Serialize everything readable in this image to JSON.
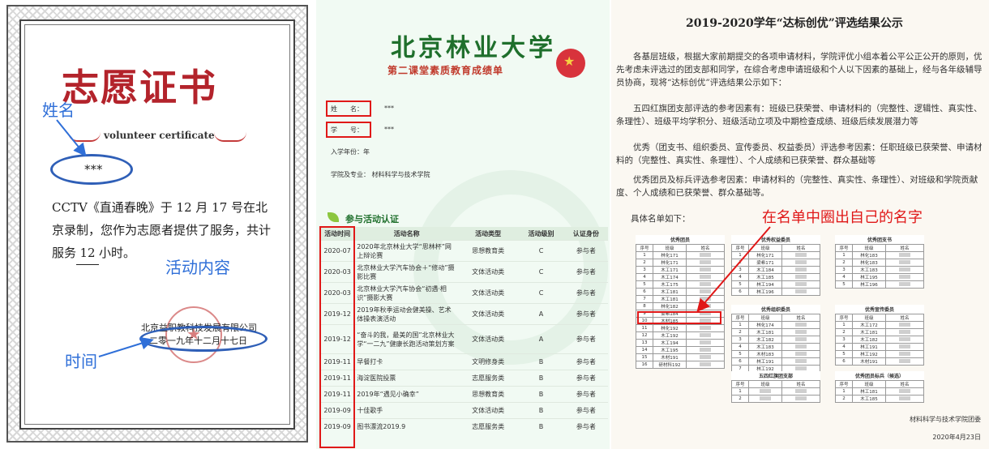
{
  "certificate": {
    "title": "志愿证书",
    "subtitle": "volunteer  certificate",
    "name": "***",
    "body_before_hours": "CCTV《直通春晚》于 12 月 17 号在北京录制，您作为志愿者提供了服务，共计服务",
    "hours": "12",
    "body_after_hours": "小时。",
    "organization": "北京益职教科技发展有限公司",
    "date": "二零一九年十二月十七日",
    "annotations": {
      "name": "姓名",
      "content": "活动内容",
      "time": "时间"
    },
    "colors": {
      "title": "#b3232b",
      "annotation": "#2f6fd8"
    }
  },
  "transcript": {
    "university": "北京林业大学",
    "subtitle": "第二课堂素质教育成绩单",
    "name_label": "姓　　名：",
    "name_value": "***",
    "id_label": "学　　号：",
    "id_value": "***",
    "year_label": "入学年份：年",
    "major_label": "学院及专业：  材料科学与技术学院",
    "section_title": "参与活动认证",
    "columns": [
      "活动时间",
      "活动名称",
      "活动类型",
      "活动级别",
      "认证身份"
    ],
    "rows": [
      [
        "2020-07",
        "2020年北京林业大学“思林杯”网上辩论赛",
        "思想教育类",
        "C",
        "参与者"
      ],
      [
        "2020-03",
        "北京林业大学汽车协会＋“修动”摄影比赛",
        "文体活动类",
        "C",
        "参与者"
      ],
      [
        "2020-03",
        "北京林业大学汽车协会“初遇·相识”摄影大赛",
        "文体活动类",
        "C",
        "参与者"
      ],
      [
        "2019-12",
        "2019年秋季运动会健美操、艺术体操表演活动",
        "文体活动类",
        "A",
        "参与者"
      ],
      [
        "2019-12",
        "“奋斗的我，最美的国”北京林业大学“一二九”健康长跑活动策划方案",
        "文体活动类",
        "A",
        "参与者"
      ],
      [
        "2019-11",
        "早餐打卡",
        "文明修身类",
        "B",
        "参与者"
      ],
      [
        "2019-11",
        "海淀医院投票",
        "志愿服务类",
        "B",
        "参与者"
      ],
      [
        "2019-11",
        "2019年“遇见小确幸”",
        "思想教育类",
        "B",
        "参与者"
      ],
      [
        "2019-09",
        "十佳歌手",
        "文体活动类",
        "B",
        "参与者"
      ],
      [
        "2019-09",
        "图书漂流2019.9",
        "志愿服务类",
        "B",
        "参与者"
      ]
    ]
  },
  "announcement": {
    "title": "2019-2020学年“达标创优”评选结果公示",
    "paragraphs": [
      "各基层班级，根据大家前期提交的各项申请材料，学院评优小组本着公平公正公开的原则，优先考虑未评选过的团支部和同学，在综合考虑申请班级和个人以下因素的基础上，经与各年级辅导员协商，现将“达标创优”评选结果公示如下：",
      "五四红旗团支部评选的参考因素有：班级已获荣誉、申请材料的（完整性、逻辑性、真实性、条理性）、班级平均学积分、班级活动立项及中期检查成绩、班级后续发展潜力等",
      "优秀（团支书、组织委员、宣传委员、权益委员）评选参考因素：任职班级已获荣誉、申请材料的（完整性、真实性、条理性）、个人成绩和已获荣誉、群众基础等",
      "优秀团员及标兵评选参考因素：申请材料的（完整性、真实性、条理性）、对班级和学院贡献度、个人成绩和已获荣誉、群众基础等。"
    ],
    "list_title": "具体名单如下：",
    "note": "在名单中圈出自己的名字",
    "footer": "材料科学与技术学院团委",
    "date": "2020年4月23日",
    "col_labels": {
      "index": "序号",
      "class": "班级",
      "name": "姓名"
    },
    "tables": {
      "excellent_member": {
        "title": "优秀团员",
        "rows": [
          [
            "1",
            "林化171"
          ],
          [
            "2",
            "林化171"
          ],
          [
            "3",
            "木工171"
          ],
          [
            "4",
            "木工174"
          ],
          [
            "5",
            "木工175"
          ],
          [
            "6",
            "木工181"
          ],
          [
            "7",
            "木工181"
          ],
          [
            "8",
            "林化182"
          ],
          [
            "9",
            "梁希184"
          ],
          [
            "10",
            "木材185"
          ],
          [
            "11",
            "林化192"
          ],
          [
            "12",
            "木工192"
          ],
          [
            "13",
            "木工194"
          ],
          [
            "14",
            "木工195"
          ],
          [
            "15",
            "木材191"
          ],
          [
            "16",
            "研材科192"
          ]
        ]
      },
      "rights_member": {
        "title": "优秀权益委员",
        "rows": [
          [
            "1",
            "林化171"
          ],
          [
            "2",
            "梁希171"
          ],
          [
            "3",
            "木工184"
          ],
          [
            "4",
            "木工185"
          ],
          [
            "5",
            "林工194"
          ],
          [
            "6",
            "林工196"
          ]
        ]
      },
      "secretary": {
        "title": "优秀团支书",
        "rows": [
          [
            "1",
            "林化183"
          ],
          [
            "2",
            "林化183"
          ],
          [
            "3",
            "木工183"
          ],
          [
            "4",
            "林工195"
          ],
          [
            "5",
            "林工196"
          ]
        ]
      },
      "organization_member": {
        "title": "优秀组织委员",
        "rows": [
          [
            "1",
            "林化174"
          ],
          [
            "2",
            "木工181"
          ],
          [
            "3",
            "木工182"
          ],
          [
            "4",
            "木工183"
          ],
          [
            "5",
            "木材183"
          ],
          [
            "6",
            "林工191"
          ],
          [
            "7",
            "林工192"
          ],
          [
            "8",
            "林工196"
          ]
        ]
      },
      "propaganda_member": {
        "title": "优秀宣传委员",
        "rows": [
          [
            "1",
            "木工172"
          ],
          [
            "2",
            "木工181"
          ],
          [
            "3",
            "木工182"
          ],
          [
            "4",
            "林工191"
          ],
          [
            "5",
            "林工192"
          ],
          [
            "6",
            "木材191"
          ]
        ]
      },
      "red_flag": {
        "title": "五四红旗团支部",
        "rows": [
          [
            "1"
          ],
          [
            "2"
          ]
        ]
      },
      "model_member": {
        "title": "优秀团员标兵（候选）",
        "rows": [
          [
            "1",
            "林工181"
          ],
          [
            "2",
            "木工185"
          ]
        ]
      }
    }
  }
}
